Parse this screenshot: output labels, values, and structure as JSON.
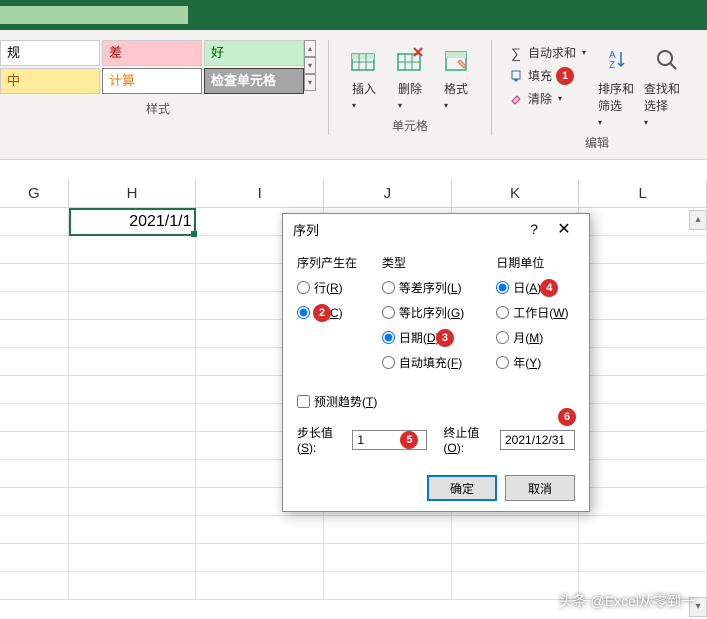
{
  "ribbon": {
    "styles": {
      "normal": "规",
      "bad": "差",
      "good": "好",
      "mid": "中",
      "calc": "计算",
      "check": "检查单元格",
      "group_label": "样式"
    },
    "cells": {
      "insert": "插入",
      "delete": "删除",
      "format": "格式",
      "group_label": "单元格"
    },
    "editing": {
      "autosum": "自动求和",
      "fill": "填充",
      "clear": "清除",
      "sort": "排序和筛选",
      "find": "查找和选择",
      "group_label": "编辑"
    }
  },
  "sheet": {
    "cols": [
      "G",
      "H",
      "I",
      "J",
      "K",
      "L"
    ],
    "active_cell": "2021/1/1"
  },
  "dialog": {
    "title": "序列",
    "section_in": "序列产生在",
    "section_type": "类型",
    "section_dateunit": "日期单位",
    "row_label": "行(R)",
    "col_label": "列(C)",
    "linear": "等差序列(L)",
    "growth": "等比序列(G)",
    "date": "日期(D)",
    "autofill": "自动填充(F)",
    "day": "日(A)",
    "weekday": "工作日(W)",
    "month": "月(M)",
    "year": "年(Y)",
    "trend": "预测趋势(T)",
    "step_label": "步长值(S):",
    "step_value": "1",
    "stop_label": "终止值(O):",
    "stop_value": "2021/12/31",
    "ok": "确定",
    "cancel": "取消"
  },
  "watermark": "头条 @Excel从零到一"
}
